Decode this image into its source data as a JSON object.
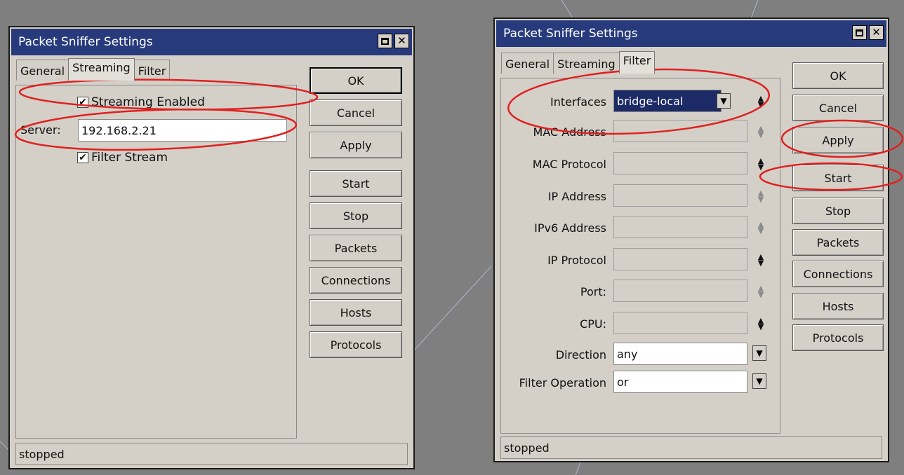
{
  "left_window": {
    "title": "Packet Sniffer Settings",
    "title_buttons": [
      "maximize-icon",
      "close-icon"
    ],
    "tabs": [
      "General",
      "Streaming",
      "Filter"
    ],
    "active_tab": "Streaming",
    "streaming_enabled": {
      "label": "Streaming Enabled",
      "checked": true
    },
    "server": {
      "label": "Server:",
      "value": "192.168.2.21"
    },
    "filter_stream": {
      "label": "Filter Stream",
      "checked": true
    },
    "buttons": [
      "OK",
      "Cancel",
      "Apply",
      "Start",
      "Stop",
      "Packets",
      "Connections",
      "Hosts",
      "Protocols"
    ],
    "status": "stopped"
  },
  "right_window": {
    "title": "Packet Sniffer Settings",
    "title_buttons": [
      "maximize-icon",
      "close-icon"
    ],
    "tabs": [
      "General",
      "Streaming",
      "Filter"
    ],
    "active_tab": "Filter",
    "fields": [
      {
        "label": "Interfaces",
        "value": "bridge-local"
      },
      {
        "label": "MAC Address",
        "value": ""
      },
      {
        "label": "MAC Protocol",
        "value": ""
      },
      {
        "label": "IP Address",
        "value": ""
      },
      {
        "label": "IPv6 Address",
        "value": ""
      },
      {
        "label": "IP Protocol",
        "value": ""
      },
      {
        "label": "Port:",
        "value": ""
      },
      {
        "label": "CPU:",
        "value": ""
      },
      {
        "label": "Direction",
        "value": "any"
      },
      {
        "label": "Filter Operation",
        "value": "or"
      }
    ],
    "buttons": [
      "OK",
      "Cancel",
      "Apply",
      "Start",
      "Stop",
      "Packets",
      "Connections",
      "Hosts",
      "Protocols"
    ],
    "status": "stopped"
  },
  "annotation_color": "#e02020"
}
